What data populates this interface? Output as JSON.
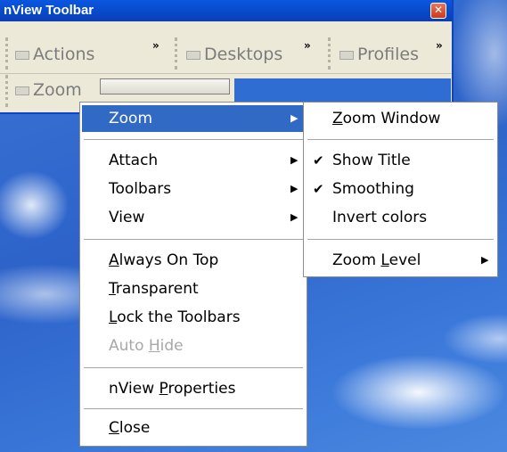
{
  "window": {
    "title": "nView Toolbar",
    "close_glyph": "✕"
  },
  "toolbar": {
    "actions_label": "Actions",
    "desktops_label": "Desktops",
    "profiles_label": "Profiles",
    "zoom_label": "Zoom",
    "overflow_glyph": "»"
  },
  "context_menu": {
    "zoom": "Zoom",
    "attach": "Attach",
    "toolbars": "Toolbars",
    "view": "View",
    "always_on_top": {
      "pre": "",
      "key": "A",
      "post": "lways On Top"
    },
    "transparent": {
      "pre": "",
      "key": "T",
      "post": "ransparent"
    },
    "lock_toolbars": {
      "pre": "",
      "key": "L",
      "post": "ock the Toolbars"
    },
    "auto_hide": {
      "pre": "Auto ",
      "key": "H",
      "post": "ide"
    },
    "nview_properties": {
      "pre": "nView ",
      "key": "P",
      "post": "roperties"
    },
    "close": {
      "pre": "",
      "key": "C",
      "post": "lose"
    },
    "submenu_arrow": "▶"
  },
  "zoom_submenu": {
    "zoom_window": {
      "pre": "",
      "key": "Z",
      "post": "oom Window"
    },
    "show_title": "Show Title",
    "smoothing": "Smoothing",
    "invert_colors": "Invert colors",
    "zoom_level": {
      "pre": "Zoom ",
      "key": "L",
      "post": "evel"
    },
    "check_glyph": "✔",
    "show_title_checked": true,
    "smoothing_checked": true
  }
}
